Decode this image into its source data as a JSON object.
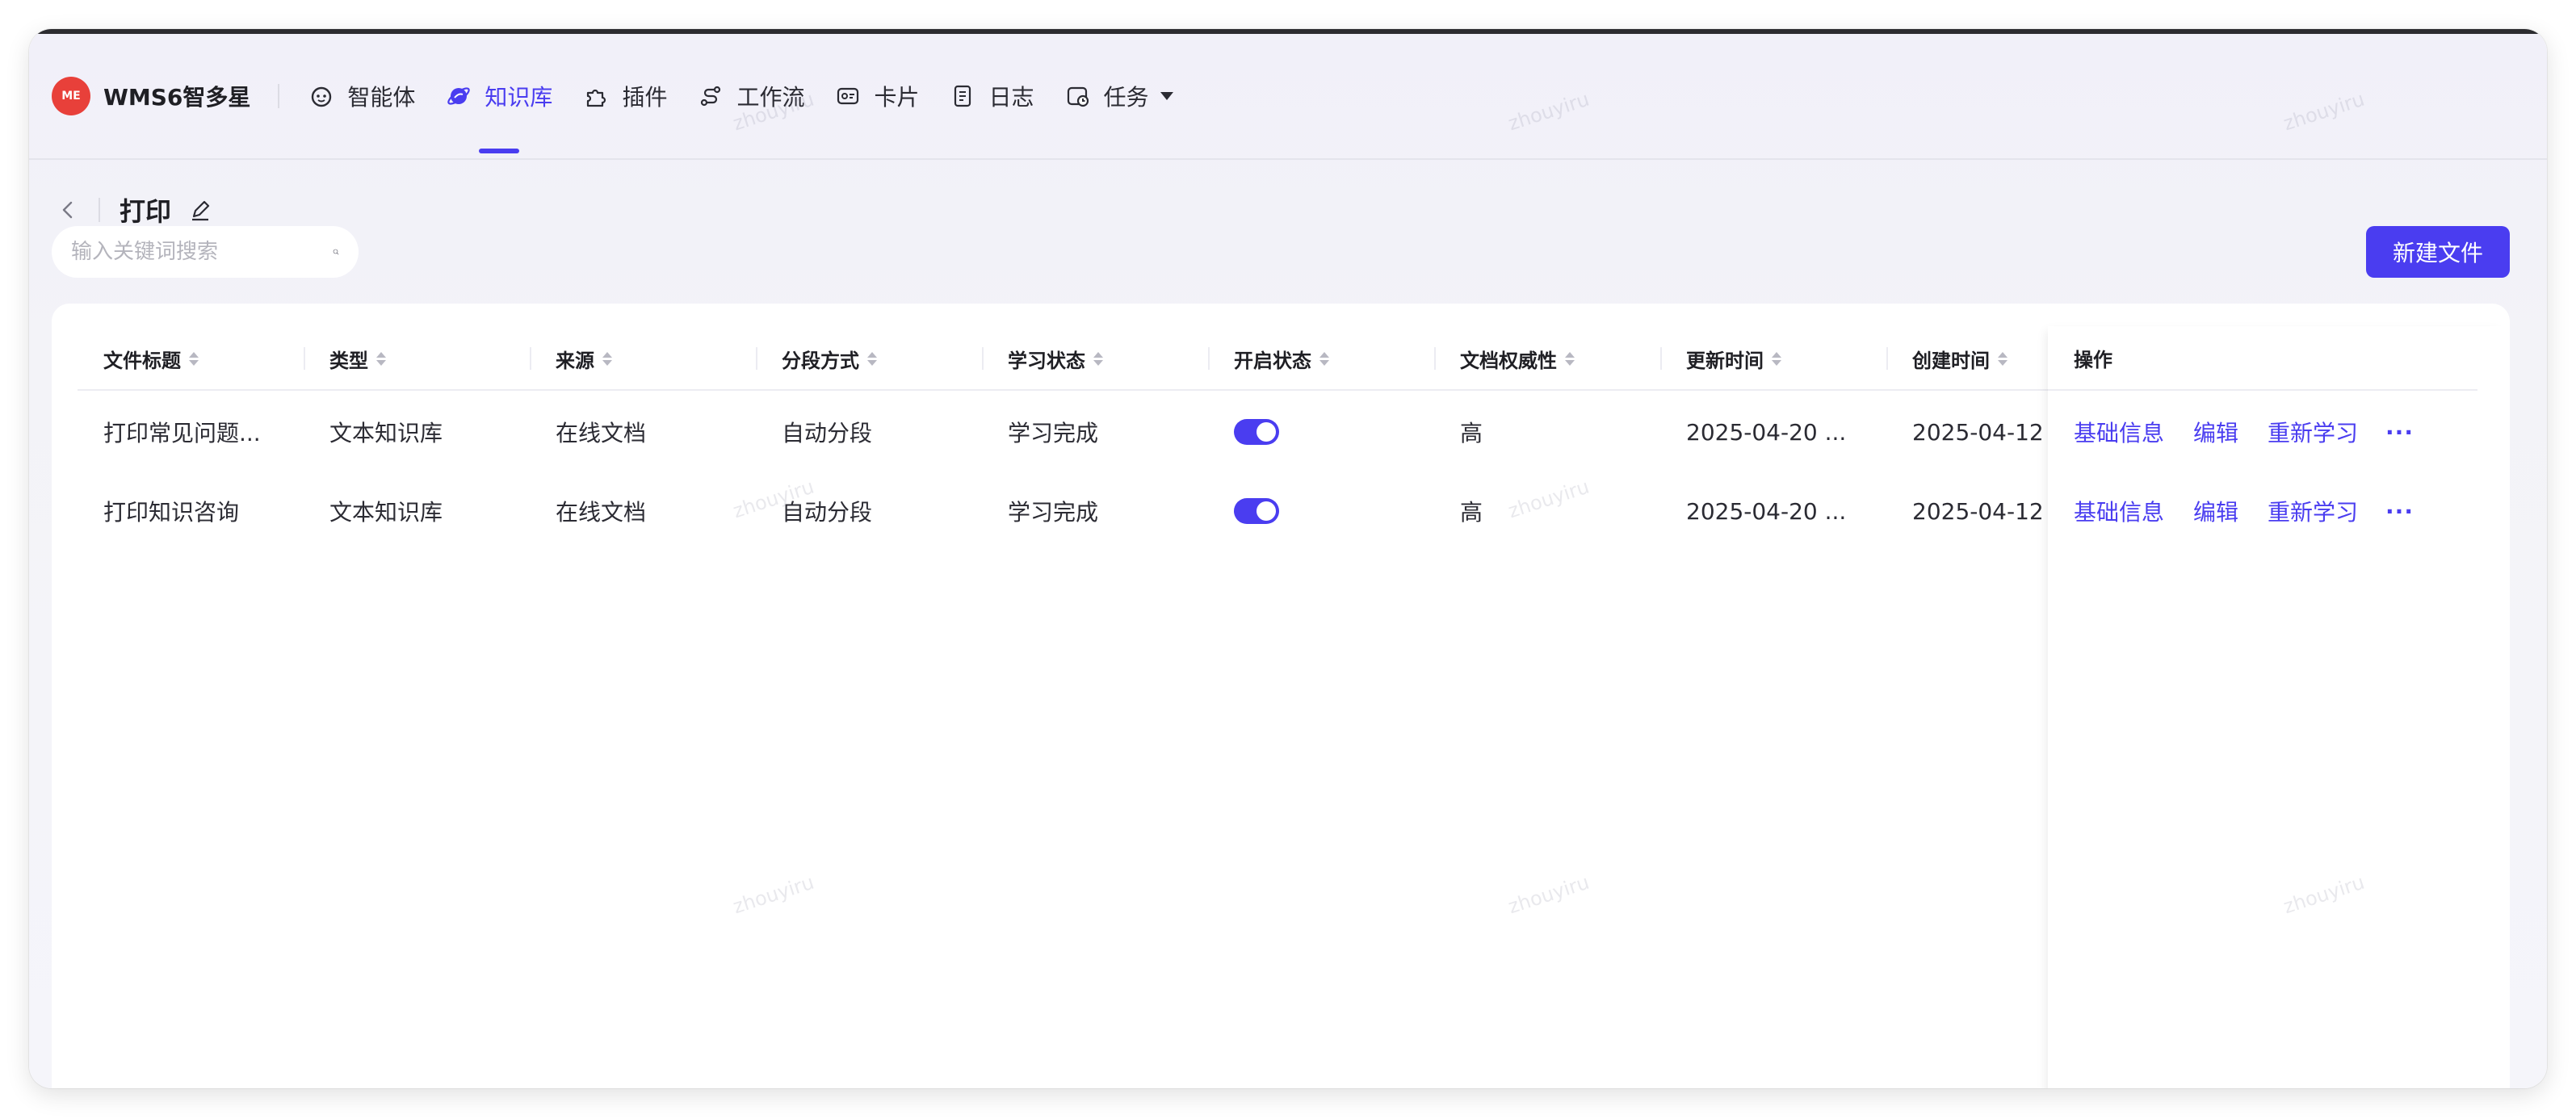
{
  "app": {
    "logo_text": "ME",
    "name": "WMS6智多星"
  },
  "nav": {
    "items": [
      {
        "label": "智能体",
        "icon": "robot-face-icon",
        "active": false
      },
      {
        "label": "知识库",
        "icon": "planet-icon",
        "active": true
      },
      {
        "label": "插件",
        "icon": "puzzle-icon",
        "active": false
      },
      {
        "label": "工作流",
        "icon": "workflow-icon",
        "active": false
      },
      {
        "label": "卡片",
        "icon": "card-icon",
        "active": false
      },
      {
        "label": "日志",
        "icon": "log-icon",
        "active": false
      },
      {
        "label": "任务",
        "icon": "task-icon",
        "active": false,
        "dropdown": true
      }
    ]
  },
  "page": {
    "title": "打印"
  },
  "search": {
    "placeholder": "输入关键词搜索",
    "value": ""
  },
  "actions": {
    "new_file": "新建文件"
  },
  "table": {
    "columns": [
      "文件标题",
      "类型",
      "来源",
      "分段方式",
      "学习状态",
      "开启状态",
      "文档权威性",
      "更新时间",
      "创建时间"
    ],
    "ops_header": "操作",
    "rows": [
      {
        "title": "打印常见问题...",
        "type": "文本知识库",
        "source": "在线文档",
        "segment": "自动分段",
        "learn_status": "学习完成",
        "enabled": true,
        "authority": "高",
        "updated": "2025-04-20 ...",
        "created": "2025-04-12"
      },
      {
        "title": "打印知识咨询",
        "type": "文本知识库",
        "source": "在线文档",
        "segment": "自动分段",
        "learn_status": "学习完成",
        "enabled": true,
        "authority": "高",
        "updated": "2025-04-20 ...",
        "created": "2025-04-12"
      }
    ],
    "ops": [
      "基础信息",
      "编辑",
      "重新学习",
      "···"
    ]
  },
  "watermark": "zhouyiru",
  "colors": {
    "accent": "#4a3df0",
    "logo": "#e8403a"
  }
}
